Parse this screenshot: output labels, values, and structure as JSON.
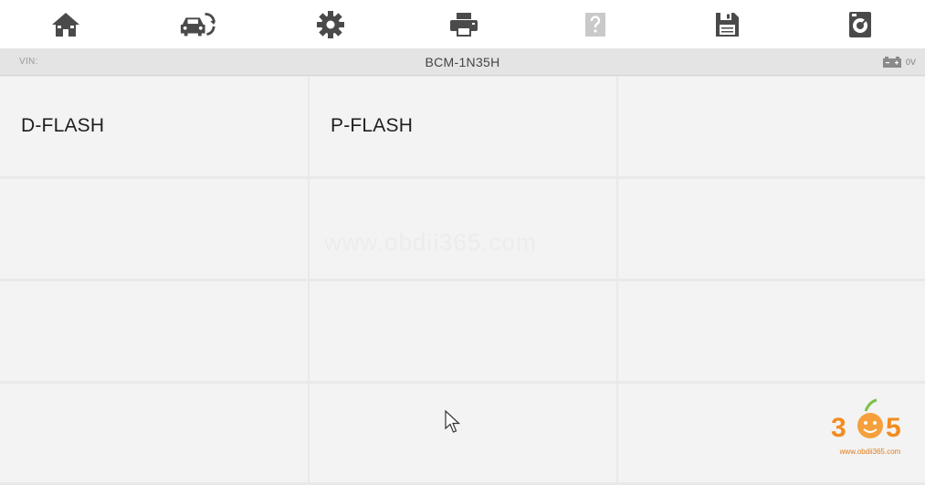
{
  "toolbar": {
    "buttons": [
      {
        "name": "home-button",
        "icon": "home-icon"
      },
      {
        "name": "vehicle-swap-button",
        "icon": "vehicle-swap-icon"
      },
      {
        "name": "settings-button",
        "icon": "gear-icon"
      },
      {
        "name": "print-button",
        "icon": "printer-icon"
      },
      {
        "name": "help-button",
        "icon": "help-icon",
        "state": "disabled"
      },
      {
        "name": "save-button",
        "icon": "floppy-disk-icon"
      },
      {
        "name": "data-logging-button",
        "icon": "data-logging-icon"
      }
    ],
    "icon_color": "#4a4a4a",
    "disabled_color": "#c9c9c9"
  },
  "status_bar": {
    "vin_label": "VIN:",
    "module_title": "BCM-1N35H",
    "voltage": "0V",
    "battery_icon": "battery-icon"
  },
  "menu": {
    "items": [
      {
        "label": "D-FLASH"
      },
      {
        "label": "P-FLASH"
      },
      {
        "label": ""
      },
      {
        "label": ""
      },
      {
        "label": ""
      },
      {
        "label": ""
      },
      {
        "label": ""
      },
      {
        "label": ""
      },
      {
        "label": ""
      },
      {
        "label": ""
      },
      {
        "label": ""
      },
      {
        "label": ""
      }
    ]
  },
  "watermark": {
    "text": "www.obdii365.com",
    "logo_text": "365",
    "logo_site": "www.obdii365.com",
    "logo_color": "#f28c1e"
  }
}
